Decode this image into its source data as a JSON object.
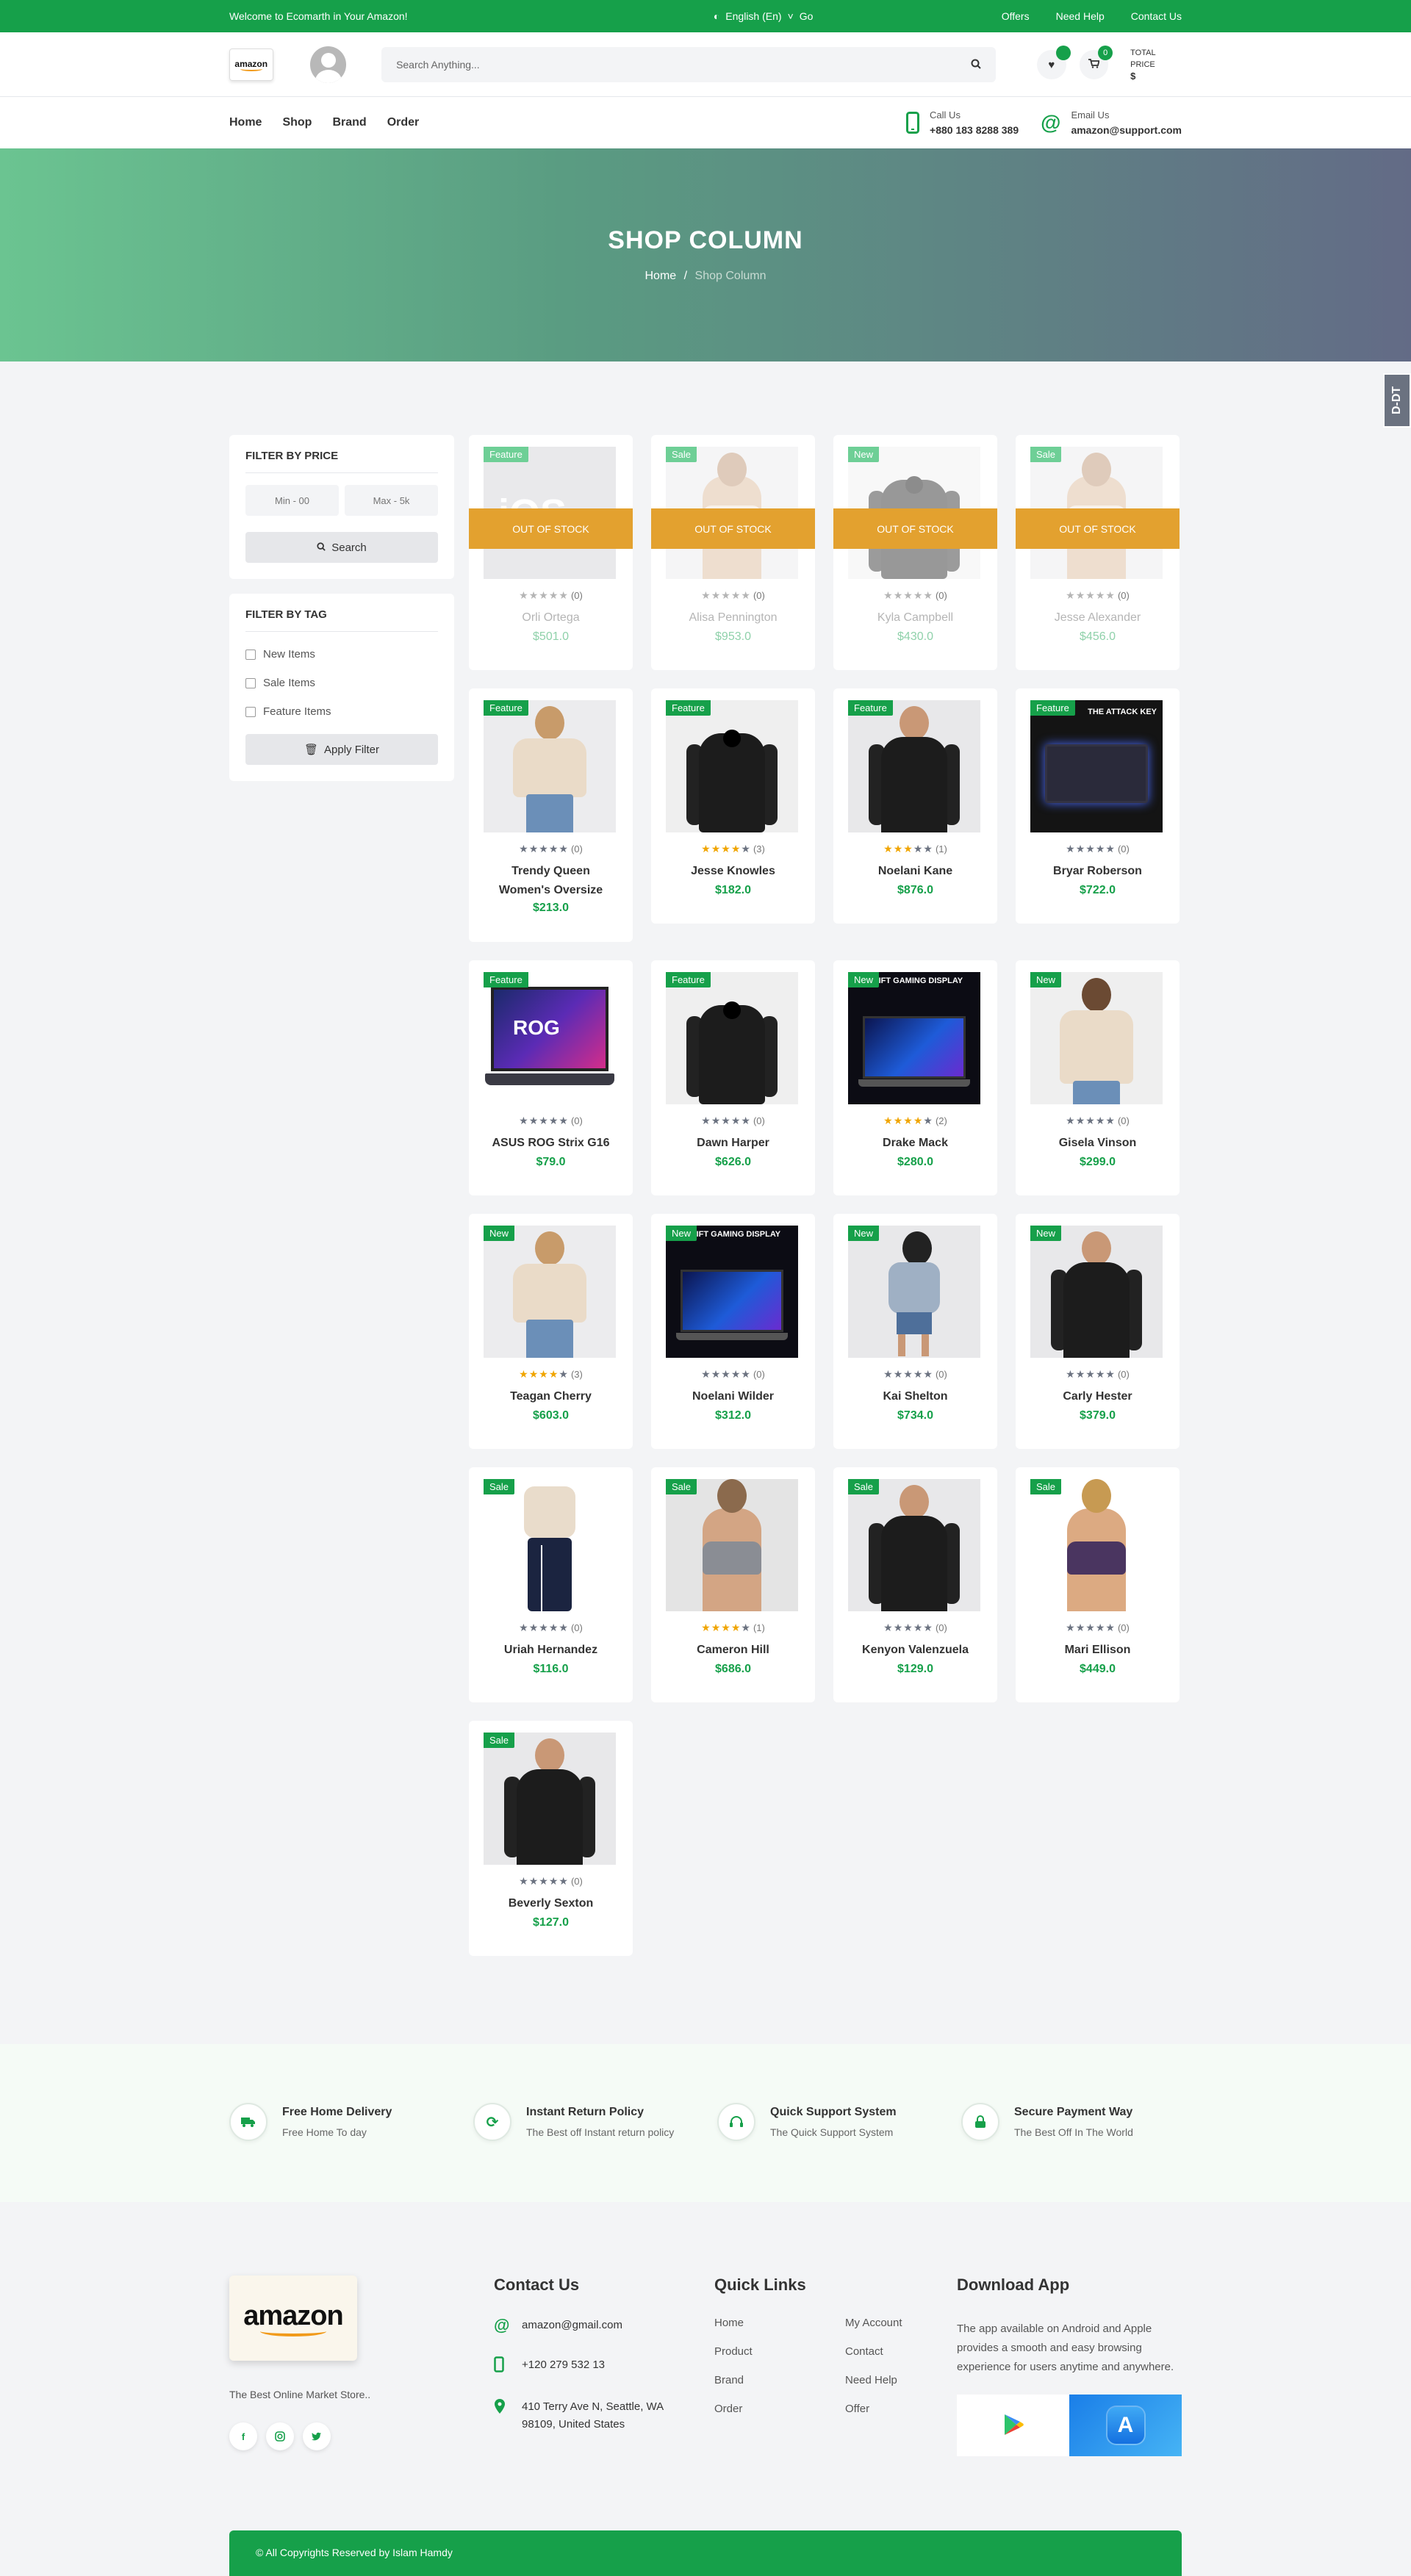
{
  "topbar": {
    "welcome": "Welcome to Ecomarth in Your Amazon!",
    "language": "English (En)",
    "go": "Go",
    "links": [
      "Offers",
      "Need Help",
      "Contact Us"
    ]
  },
  "header": {
    "logo_text": "amazon",
    "search_placeholder": "Search Anything...",
    "wishlist_count": "",
    "cart_count": "0",
    "total_label": "TOTAL PRICE",
    "total_value": "$"
  },
  "nav": {
    "links": [
      "Home",
      "Shop",
      "Brand",
      "Order"
    ],
    "call_label": "Call Us",
    "call_value": "+880 183 8288 389",
    "email_label": "Email Us",
    "email_value": "amazon@support.com"
  },
  "hero": {
    "title": "SHOP COLUMN",
    "crumb_home": "Home",
    "crumb_sep": "/",
    "crumb_current": "Shop Column"
  },
  "side_tab": "D-DT",
  "filters": {
    "price_title": "FILTER BY PRICE",
    "min_placeholder": "Min - 00",
    "max_placeholder": "Max - 5k",
    "search_label": "Search",
    "tag_title": "FILTER BY TAG",
    "tags": [
      "New Items",
      "Sale Items",
      "Feature Items"
    ],
    "apply_label": "Apply Filter"
  },
  "out_of_stock_label": "OUT OF STOCK",
  "products": [
    {
      "label": "Feature",
      "name": "Orli Ortega",
      "price": "$501.0",
      "rating": 0,
      "count": "(0)",
      "oos": true,
      "img": "apple"
    },
    {
      "label": "Sale",
      "name": "Alisa Pennington",
      "price": "$953.0",
      "rating": 0,
      "count": "(0)",
      "oos": true,
      "img": "model"
    },
    {
      "label": "New",
      "name": "Kyla Campbell",
      "price": "$430.0",
      "rating": 0,
      "count": "(0)",
      "oos": true,
      "img": "hoodie"
    },
    {
      "label": "Sale",
      "name": "Jesse Alexander",
      "price": "$456.0",
      "rating": 0,
      "count": "(0)",
      "oos": true,
      "img": "model"
    },
    {
      "label": "Feature",
      "name": "Trendy Queen Women's Oversize",
      "price": "$213.0",
      "rating": 0,
      "count": "(0)",
      "oos": false,
      "img": "sweater"
    },
    {
      "label": "Feature",
      "name": "Jesse Knowles",
      "price": "$182.0",
      "rating": 4,
      "count": "(3)",
      "oos": false,
      "img": "hoodie"
    },
    {
      "label": "Feature",
      "name": "Noelani Kane",
      "price": "$876.0",
      "rating": 3,
      "count": "(1)",
      "oos": false,
      "img": "hoodie-model"
    },
    {
      "label": "Feature",
      "name": "Bryar Roberson",
      "price": "$722.0",
      "rating": 0,
      "count": "(0)",
      "oos": false,
      "img": "keyboard"
    },
    {
      "label": "Feature",
      "name": "ASUS ROG Strix G16",
      "price": "$79.0",
      "rating": 0,
      "count": "(0)",
      "oos": false,
      "img": "laptop"
    },
    {
      "label": "Feature",
      "name": "Dawn Harper",
      "price": "$626.0",
      "rating": 0,
      "count": "(0)",
      "oos": false,
      "img": "hoodie"
    },
    {
      "label": "New",
      "name": "Drake Mack",
      "price": "$280.0",
      "rating": 4,
      "count": "(2)",
      "oos": false,
      "img": "display"
    },
    {
      "label": "New",
      "name": "Gisela Vinson",
      "price": "$299.0",
      "rating": 0,
      "count": "(0)",
      "oos": false,
      "img": "sweater-back"
    },
    {
      "label": "New",
      "name": "Teagan Cherry",
      "price": "$603.0",
      "rating": 4,
      "count": "(3)",
      "oos": false,
      "img": "sweater"
    },
    {
      "label": "New",
      "name": "Noelani Wilder",
      "price": "$312.0",
      "rating": 0,
      "count": "(0)",
      "oos": false,
      "img": "display"
    },
    {
      "label": "New",
      "name": "Kai Shelton",
      "price": "$734.0",
      "rating": 0,
      "count": "(0)",
      "oos": false,
      "img": "walker"
    },
    {
      "label": "New",
      "name": "Carly Hester",
      "price": "$379.0",
      "rating": 0,
      "count": "(0)",
      "oos": false,
      "img": "hoodie-model"
    },
    {
      "label": "Sale",
      "name": "Uriah Hernandez",
      "price": "$116.0",
      "rating": 0,
      "count": "(0)",
      "oos": false,
      "img": "pants"
    },
    {
      "label": "Sale",
      "name": "Cameron Hill",
      "price": "$686.0",
      "rating": 4,
      "count": "(1)",
      "oos": false,
      "img": "bra"
    },
    {
      "label": "Sale",
      "name": "Kenyon Valenzuela",
      "price": "$129.0",
      "rating": 0,
      "count": "(0)",
      "oos": false,
      "img": "hoodie-model"
    },
    {
      "label": "Sale",
      "name": "Mari Ellison",
      "price": "$449.0",
      "rating": 0,
      "count": "(0)",
      "oos": false,
      "img": "bra-purple"
    },
    {
      "label": "Sale",
      "name": "Beverly Sexton",
      "price": "$127.0",
      "rating": 0,
      "count": "(0)",
      "oos": false,
      "img": "hoodie-model"
    }
  ],
  "image_text": {
    "keyboard": "THE ATTACK KEY",
    "display": "SWIFT GAMING DISPLAY",
    "laptop": "ROG",
    "apple": "iOS"
  },
  "features": [
    {
      "title": "Free Home Delivery",
      "sub": "Free Home To day",
      "icon": "truck-icon"
    },
    {
      "title": "Instant Return Policy",
      "sub": "The Best off Instant return policy",
      "icon": "refresh-icon"
    },
    {
      "title": "Quick Support System",
      "sub": "The Quick Support System",
      "icon": "headset-icon"
    },
    {
      "title": "Secure Payment Way",
      "sub": "The Best Off In The World",
      "icon": "lock-icon"
    }
  ],
  "footer": {
    "logo_text": "amazon",
    "tagline": "The Best Online Market Store..",
    "socials": [
      "f",
      "ig",
      "tw"
    ],
    "contact_title": "Contact Us",
    "email": "amazon@gmail.com",
    "phone": "+120 279 532 13",
    "address": "410 Terry Ave N, Seattle, WA 98109, United States",
    "quick_title": "Quick Links",
    "quick_links": [
      "Home",
      "My Account",
      "Product",
      "Contact",
      "Brand",
      "Need Help",
      "Order",
      "Offer"
    ],
    "app_title": "Download App",
    "app_text": "The app available on Android and Apple provides a smooth and easy browsing experience for users anytime and anywhere.",
    "copyright": "© All Copyrights Reserved by Islam Hamdy"
  },
  "colors": {
    "brand": "#16a04a",
    "oos": "#e3a12f"
  }
}
